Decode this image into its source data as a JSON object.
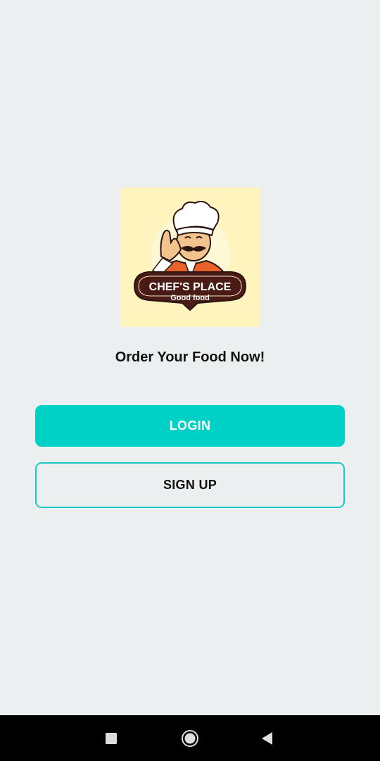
{
  "logo": {
    "title": "CHEF'S PLACE",
    "subtitle": "Good food",
    "colors": {
      "background": "#FFF3BE",
      "banner": "#4A1A14",
      "jacket": "#E8622A"
    }
  },
  "main": {
    "tagline": "Order Your Food Now!",
    "login_label": "LOGIN",
    "signup_label": "SIGN UP"
  },
  "colors": {
    "accent": "#00D1C7",
    "background": "#ECEFF0"
  },
  "navbar": {
    "icons": [
      "recent-apps-icon",
      "home-icon",
      "back-icon"
    ]
  }
}
